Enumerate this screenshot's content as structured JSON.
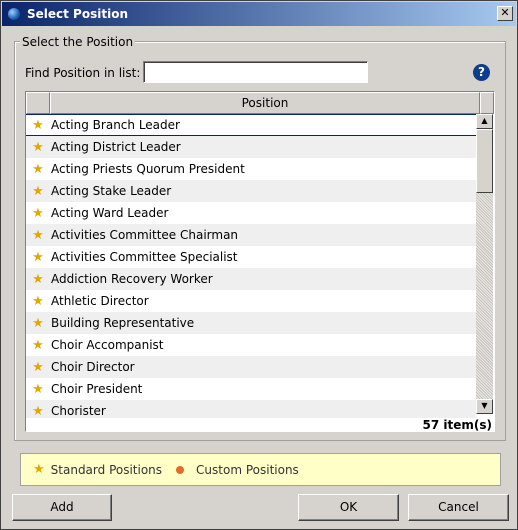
{
  "window": {
    "title": "Select Position",
    "close_symbol": "✕"
  },
  "group": {
    "legend": "Select the Position"
  },
  "search": {
    "label": "Find Position in list:",
    "value": "",
    "placeholder": ""
  },
  "help": {
    "symbol": "?"
  },
  "table": {
    "column_header": "Position",
    "rows": [
      "Acting Branch Leader",
      "Acting District Leader",
      "Acting Priests Quorum President",
      "Acting Stake Leader",
      "Acting Ward Leader",
      "Activities Committee Chairman",
      "Activities Committee Specialist",
      "Addiction Recovery Worker",
      "Athletic Director",
      "Building Representative",
      "Choir Accompanist",
      "Choir Director",
      "Choir President",
      "Chorister"
    ],
    "selected_index": 0,
    "count_text": "57 item(s)"
  },
  "legend": {
    "standard_label": "Standard Positions",
    "custom_label": "Custom Positions"
  },
  "buttons": {
    "add": "Add",
    "ok": "OK",
    "cancel": "Cancel"
  },
  "icons": {
    "row_icon": "star-icon",
    "standard_icon": "star-icon",
    "custom_icon": "orange-dot-icon"
  },
  "colors": {
    "star": "#e0a800",
    "custom_dot": "#e86a2a",
    "legend_bg": "#ffffc8"
  }
}
